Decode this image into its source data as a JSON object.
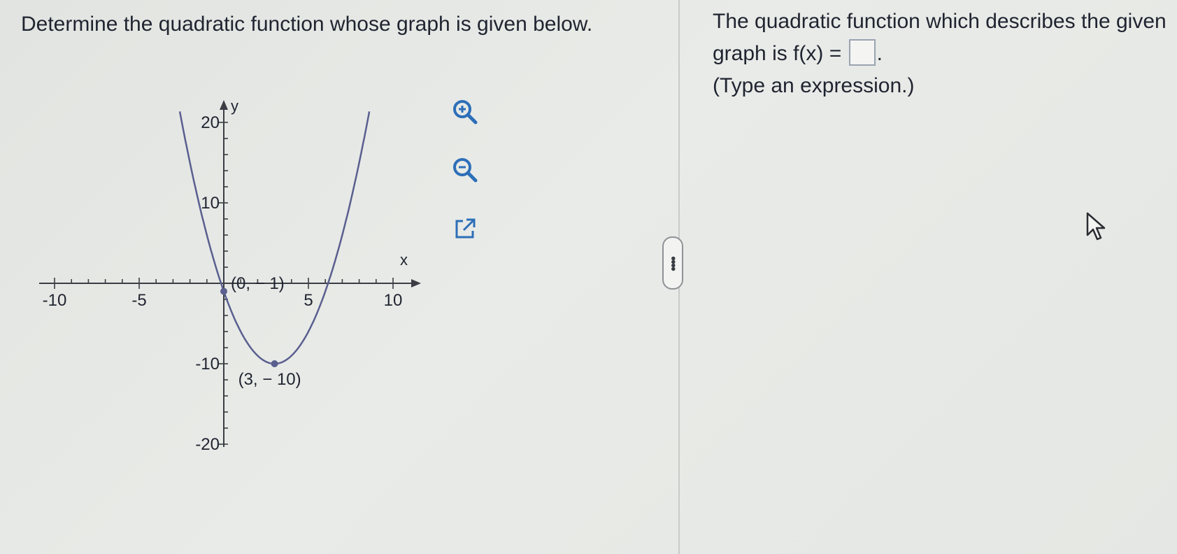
{
  "question": {
    "text": "Determine the quadratic function whose graph is given below."
  },
  "graph": {
    "x_axis_label": "x",
    "y_axis_label": "y",
    "x_tick_labels": [
      "-10",
      "-5",
      "5",
      "10"
    ],
    "y_tick_labels": [
      "20",
      "10",
      "-10",
      "-20"
    ],
    "points": [
      {
        "x": 0,
        "y": -1,
        "label": "(0, − 1)"
      },
      {
        "x": 3,
        "y": -10,
        "label": "(3, − 10)"
      }
    ],
    "curve_color": "#5a5f8f"
  },
  "tools": {
    "zoom_in": "zoom-in-icon",
    "zoom_out": "zoom-out-icon",
    "popout": "external-link-icon"
  },
  "answer": {
    "line1": "The quadratic function which describes the given",
    "line2_prefix": "graph is f(x) =",
    "line2_suffix": ".",
    "hint": "(Type an expression.)",
    "input_value": ""
  },
  "colors": {
    "accent": "#2d6fb8",
    "text": "#1f2430"
  }
}
